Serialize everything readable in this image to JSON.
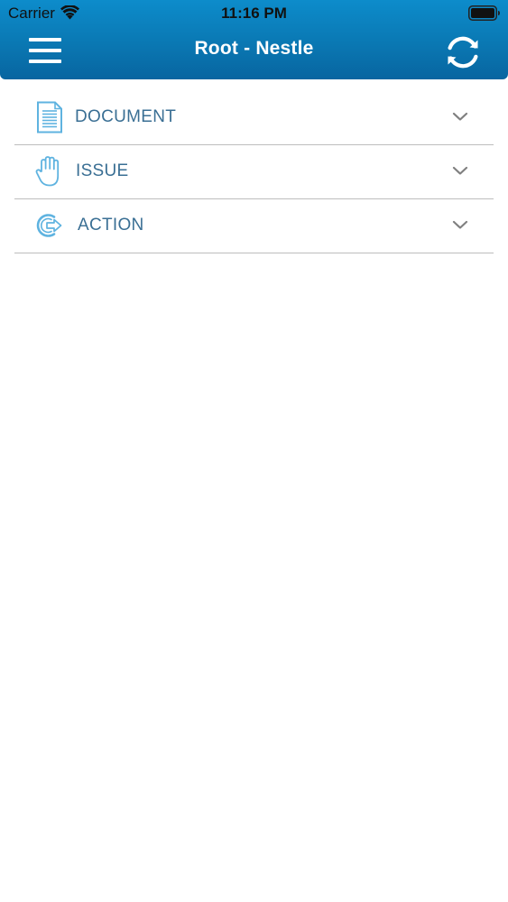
{
  "status_bar": {
    "carrier": "Carrier",
    "time": "11:16 PM"
  },
  "nav_bar": {
    "title": "Root - Nestle"
  },
  "sections": [
    {
      "label": "DOCUMENT",
      "icon": "document-icon"
    },
    {
      "label": "ISSUE",
      "icon": "hand-icon"
    },
    {
      "label": "ACTION",
      "icon": "action-icon"
    }
  ],
  "colors": {
    "nav_gradient_top": "#0d8ccb",
    "nav_gradient_bottom": "#0865a0",
    "label_text": "#3a6f94",
    "icon_accent": "#5fb3e0",
    "divider": "#bdbdbd"
  }
}
